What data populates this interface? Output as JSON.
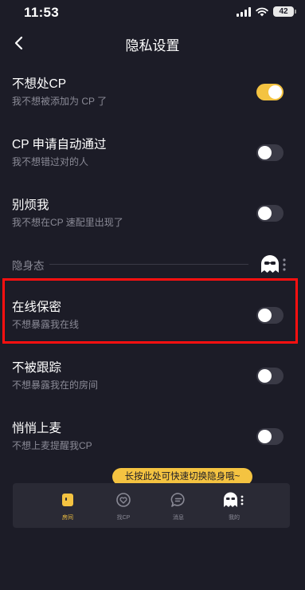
{
  "status_bar": {
    "time": "11:53",
    "battery": "42"
  },
  "header": {
    "title": "隐私设置"
  },
  "settings": [
    {
      "title": "不想处CP",
      "desc": "我不想被添加为 CP 了",
      "enabled": true
    },
    {
      "title": "CP 申请自动通过",
      "desc": "我不想错过对的人",
      "enabled": false
    },
    {
      "title": "别烦我",
      "desc": "我不想在CP 速配里出现了",
      "enabled": false
    }
  ],
  "stealth_section": {
    "label": "隐身态",
    "settings": [
      {
        "title": "在线保密",
        "desc": "不想暴露我在线",
        "enabled": false
      },
      {
        "title": "不被跟踪",
        "desc": "不想暴露我在的房间",
        "enabled": false
      },
      {
        "title": "悄悄上麦",
        "desc": "不想上麦提醒我CP",
        "enabled": false
      }
    ]
  },
  "tooltip": {
    "text": "长按此处可快速切换隐身哦~"
  },
  "bottom_nav": [
    {
      "label": "房间",
      "icon": "room-icon",
      "active": true
    },
    {
      "label": "找CP",
      "icon": "find-cp-icon",
      "active": false
    },
    {
      "label": "消息",
      "icon": "message-icon",
      "active": false
    },
    {
      "label": "我的",
      "icon": "ghost-icon",
      "active": false
    }
  ],
  "colors": {
    "background": "#1c1c27",
    "accent": "#f4c341",
    "highlight": "#ff1010",
    "toggle_off": "#3a3a46"
  }
}
